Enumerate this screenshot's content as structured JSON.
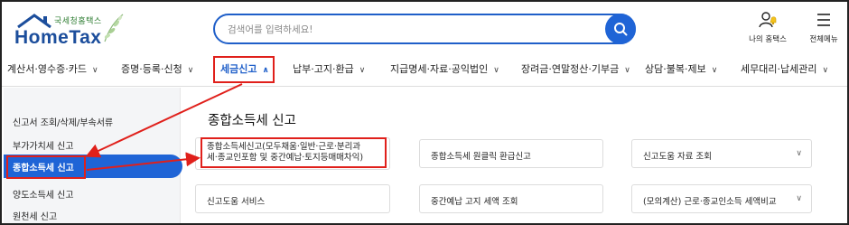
{
  "header": {
    "logo_small": "국세청홈택스",
    "logo_big": "HomeTax",
    "search_placeholder": "검색어를 입력하세요!",
    "tools": [
      {
        "label": "나의 홈택스",
        "icon": "person-bell-icon"
      },
      {
        "label": "전체메뉴",
        "icon": "hamburger-menu-icon"
      }
    ]
  },
  "nav": {
    "items": [
      {
        "label": "계산서·영수증·카드",
        "active": false
      },
      {
        "label": "증명·등록·신청",
        "active": false
      },
      {
        "label": "세금신고",
        "active": true
      },
      {
        "label": "납부·고지·환급",
        "active": false
      },
      {
        "label": "지급명세·자료·공익법인",
        "active": false
      },
      {
        "label": "장려금·연말정산·기부금",
        "active": false
      },
      {
        "label": "상담·불복·제보",
        "active": false
      },
      {
        "label": "세무대리·납세관리",
        "active": false
      }
    ]
  },
  "sidebar": {
    "items": [
      {
        "label": "신고서 조회/삭제/부속서류"
      },
      {
        "label": "부가가치세 신고"
      },
      {
        "label": "종합소득세 신고",
        "active": true
      },
      {
        "label": "양도소득세 신고"
      },
      {
        "label": "원천세 신고"
      }
    ]
  },
  "main": {
    "title": "종합소득세 신고",
    "cards": [
      {
        "label": "종합소득세신고(모두채움·일반·근로·분리과세·종교인포함 및 중간예납·토지등매매차익)",
        "line1": "종합소득세신고(모두채움·일반·근로·분리과",
        "line2": "세·종교인포함 및 중간예납·토지등매매차익)"
      },
      {
        "label": "종합소득세 원클릭 환급신고"
      },
      {
        "label": "신고도움 자료 조회",
        "chevron": true
      },
      {
        "label": "신고도움 서비스"
      },
      {
        "label": "중간예납 고지 세액 조회"
      },
      {
        "label": "(모의계산) 근로·종교인소득 세액비교",
        "chevron": true
      }
    ]
  },
  "colors": {
    "brand_blue": "#1f64d6",
    "logo_navy": "#1c4e9c",
    "annotation_red": "#e0201b",
    "sidebar_bg": "#f4f5f7"
  }
}
